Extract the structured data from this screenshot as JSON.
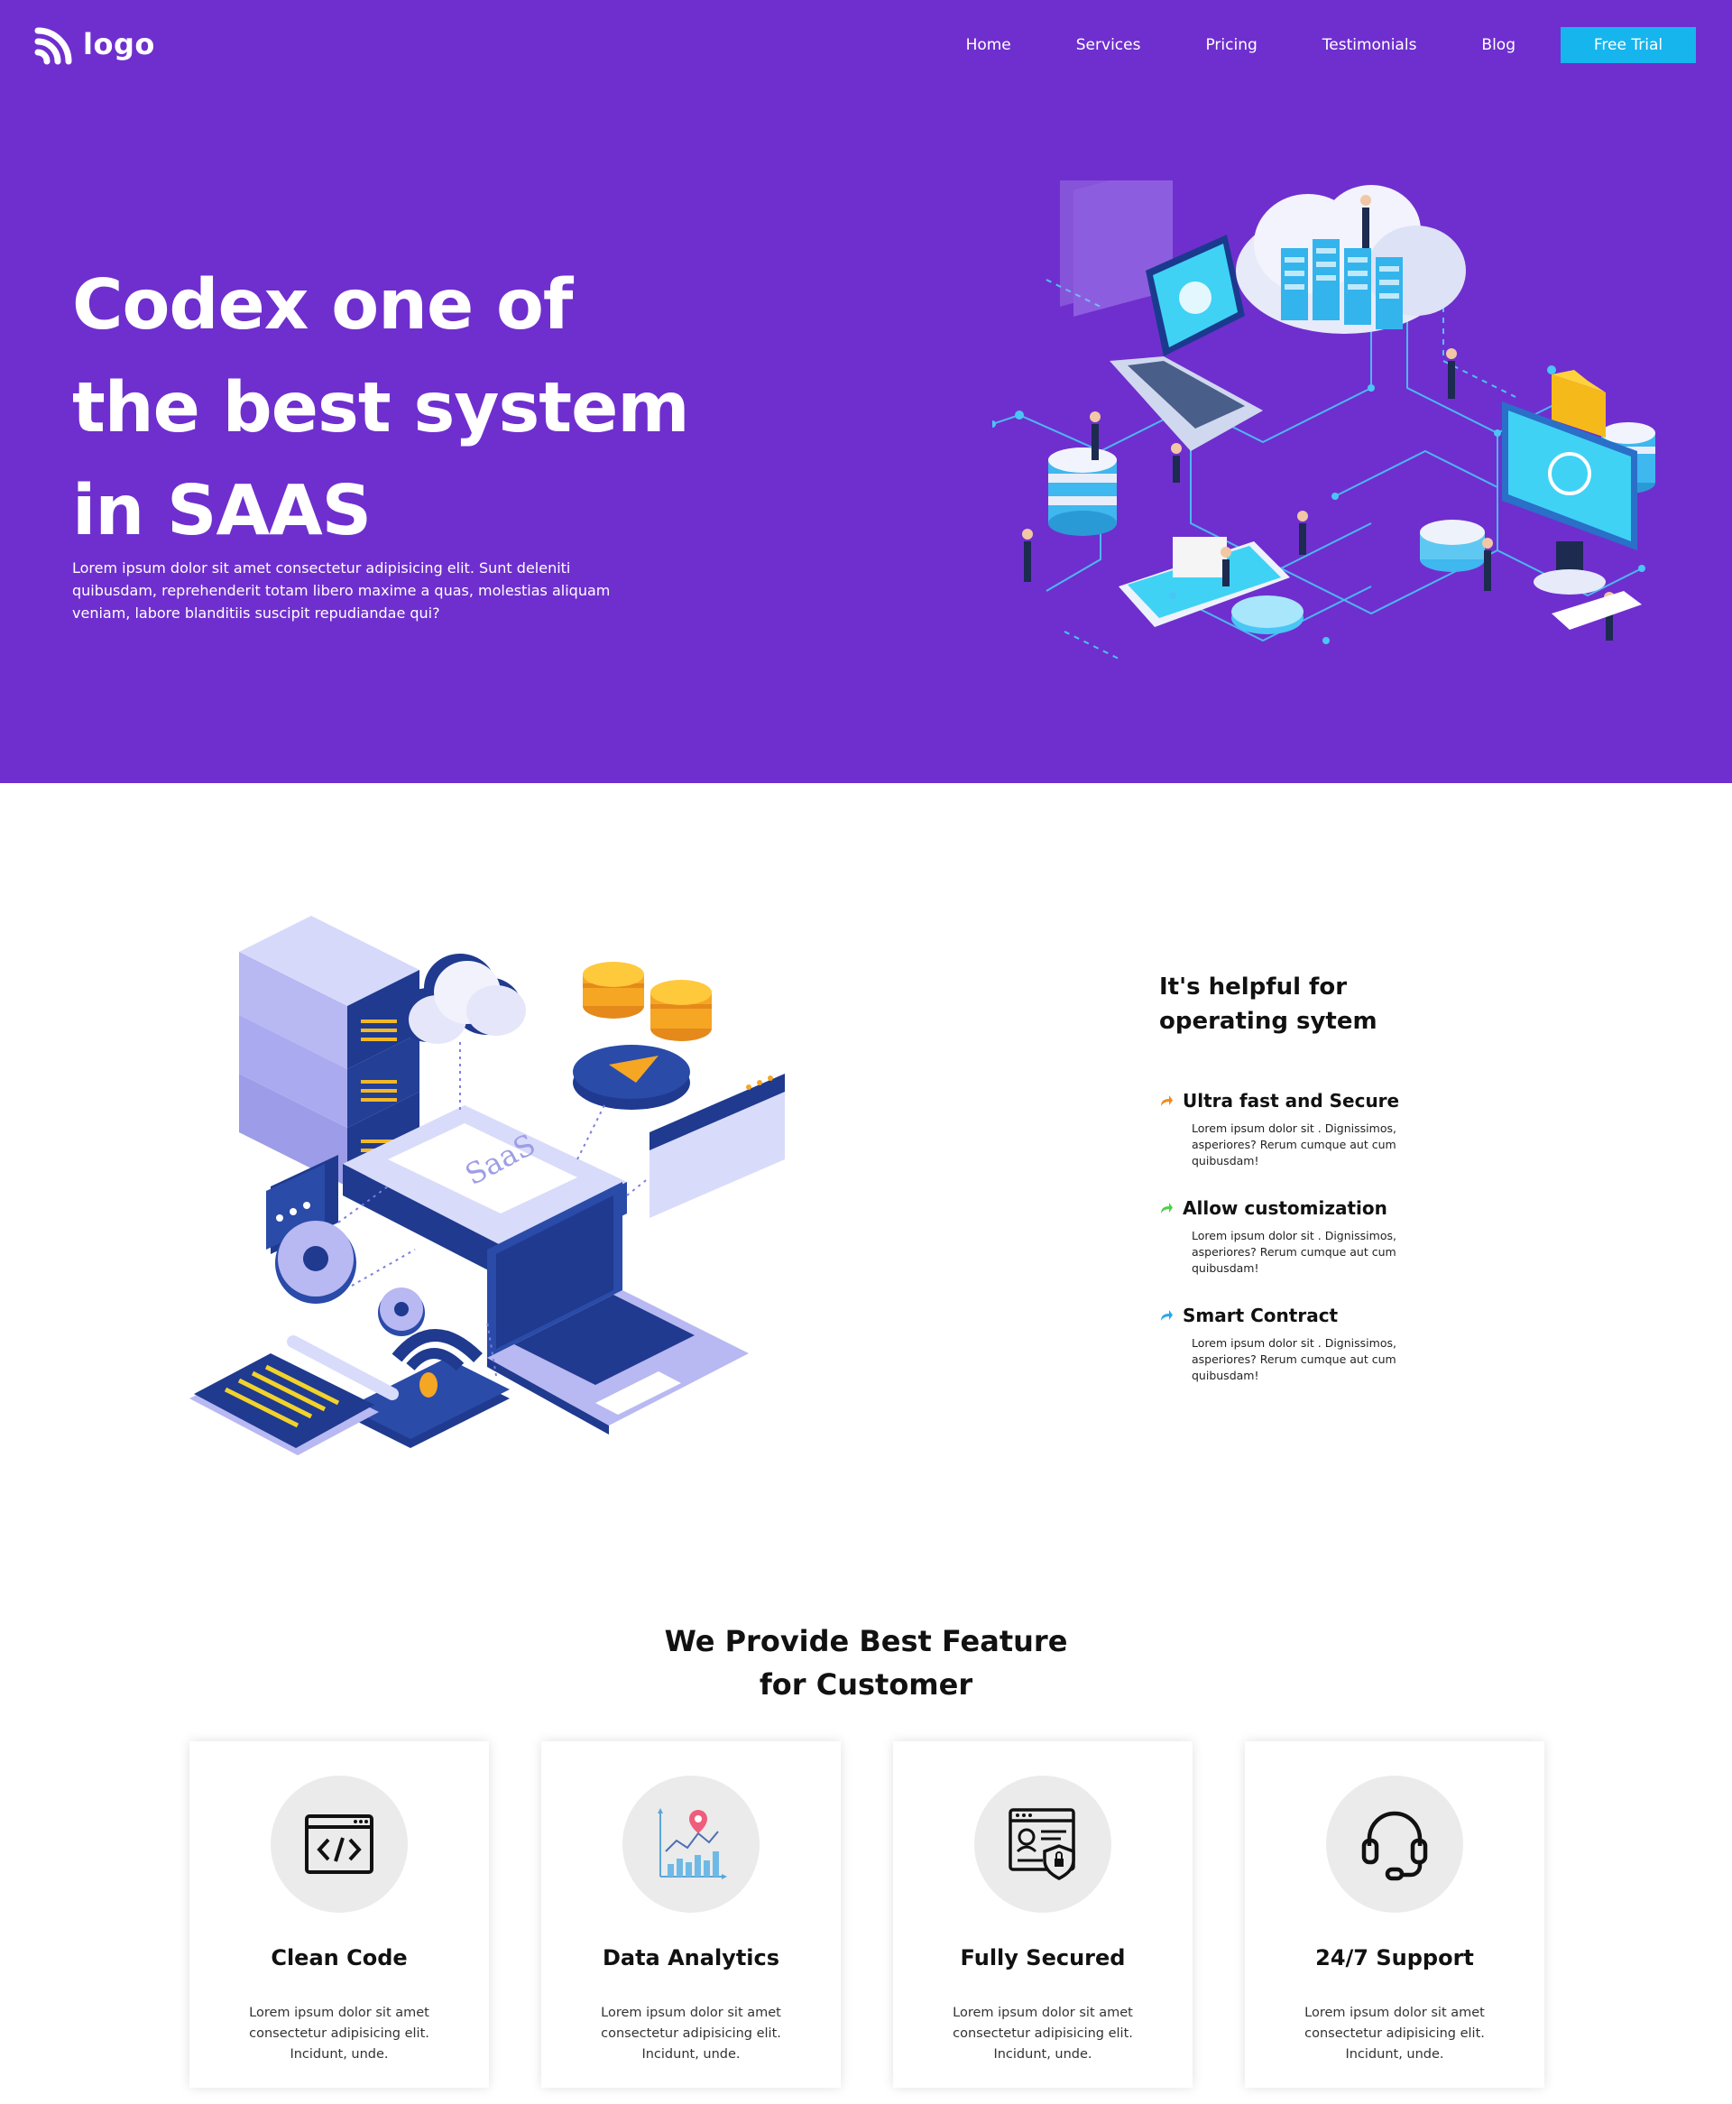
{
  "header": {
    "logo_text": "logo",
    "nav": [
      "Home",
      "Services",
      "Pricing",
      "Testimonials",
      "Blog"
    ],
    "cta": "Free Trial"
  },
  "hero": {
    "title": "Codex one of the best system in SAAS",
    "description": "Lorem ipsum dolor sit amet consectetur adipisicing elit. Sunt deleniti quibusdam, reprehenderit totam libero maxime a quas, molestias aliquam veniam, labore blanditiis suscipit repudiandae qui?"
  },
  "illustration2": {
    "saas_label": "SaaS"
  },
  "helpful": {
    "title": "It's helpful for operating sytem",
    "items": [
      {
        "name": "Ultra fast and Secure",
        "desc": "Lorem ipsum dolor sit . Dignissimos, asperiores? Rerum cumque aut cum quibusdam!",
        "arrow_color": "#f28a1e"
      },
      {
        "name": "Allow customization",
        "desc": "Lorem ipsum dolor sit . Dignissimos, asperiores? Rerum cumque aut cum quibusdam!",
        "arrow_color": "#4fd14a"
      },
      {
        "name": "Smart Contract",
        "desc": "Lorem ipsum dolor sit . Dignissimos, asperiores? Rerum cumque aut cum quibusdam!",
        "arrow_color": "#2aa9e6"
      }
    ]
  },
  "features": {
    "title_line1": "We Provide Best Feature",
    "title_line2": "for Customer",
    "cards": [
      {
        "icon": "code-window-icon",
        "title": "Clean Code",
        "desc": "Lorem ipsum dolor sit amet consectetur adipisicing elit. Incidunt, unde."
      },
      {
        "icon": "analytics-chart-icon",
        "title": "Data Analytics",
        "desc": "Lorem ipsum dolor sit amet consectetur adipisicing elit. Incidunt, unde."
      },
      {
        "icon": "secure-profile-icon",
        "title": "Fully Secured",
        "desc": "Lorem ipsum dolor sit amet consectetur adipisicing elit. Incidunt, unde."
      },
      {
        "icon": "headset-icon",
        "title": "24/7 Support",
        "desc": "Lorem ipsum dolor sit amet consectetur adipisicing elit. Incidunt, unde."
      }
    ]
  },
  "colors": {
    "hero_bg": "#6f2fce",
    "cta_bg": "#16b5ee",
    "card_icon_bg": "#ebebeb"
  }
}
